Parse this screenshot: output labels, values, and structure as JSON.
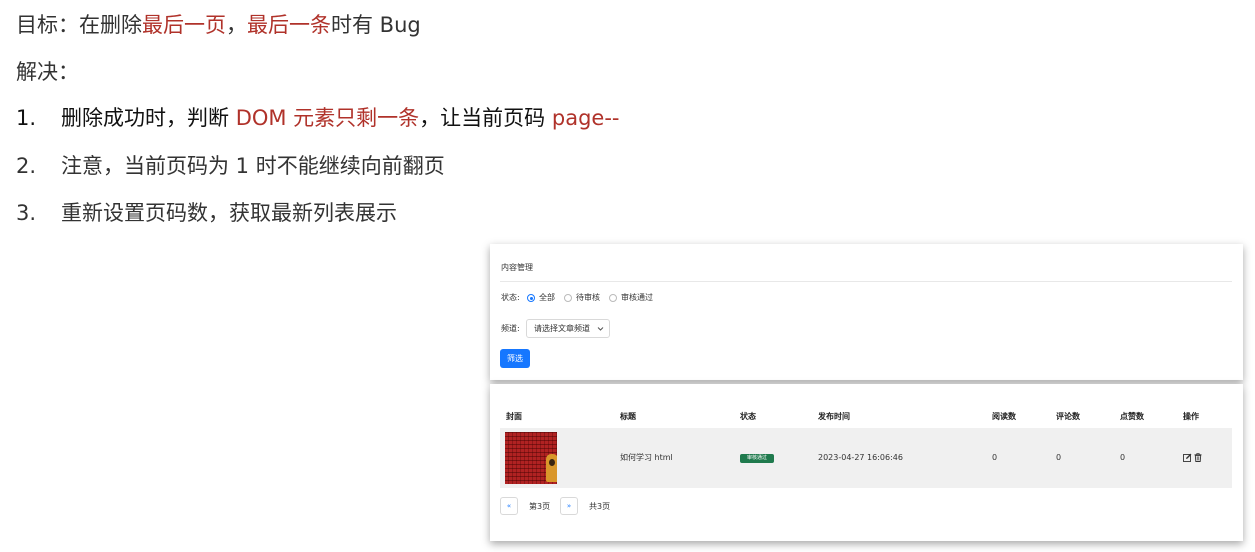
{
  "notes": {
    "goal": {
      "prefix": "目标：在删除",
      "highlight1": "最后一页",
      "comma": "，",
      "highlight2": "最后一条",
      "suffix": "时有 Bug"
    },
    "solve_label": "解决：",
    "steps": [
      {
        "num": "1.",
        "text_a": "删除成功时，判断 ",
        "highlight_a": "DOM 元素只剩一条",
        "text_b": "，让当前页码 ",
        "highlight_b": "page--"
      },
      {
        "num": "2.",
        "text": "注意，当前页码为 1 时不能继续向前翻页"
      },
      {
        "num": "3.",
        "text": "重新设置页码数，获取最新列表展示"
      }
    ]
  },
  "filter_card": {
    "breadcrumb": "内容管理",
    "status_label": "状态:",
    "status_options": [
      {
        "label": "全部",
        "selected": true
      },
      {
        "label": "待审核",
        "selected": false
      },
      {
        "label": "审核通过",
        "selected": false
      }
    ],
    "channel_label": "频道:",
    "channel_placeholder": "请选择文章频道",
    "filter_button": "筛选"
  },
  "table": {
    "columns": [
      "封面",
      "标题",
      "状态",
      "发布时间",
      "阅读数",
      "评论数",
      "点赞数",
      "操作"
    ],
    "rows": [
      {
        "title": "如何学习 html",
        "status": "审核通过",
        "publish_time": "2023-04-27 16:06:46",
        "reads": "0",
        "comments": "0",
        "likes": "0"
      }
    ],
    "action_icons": [
      "edit-icon",
      "trash-icon"
    ]
  },
  "pagination": {
    "prev_symbol": "«",
    "current_page": "第3页",
    "next_symbol": "»",
    "total_pages": "共3页"
  },
  "colors": {
    "highlight_red": "#b0322a",
    "primary_blue": "#1677ff",
    "status_green": "#1f7a4d"
  }
}
